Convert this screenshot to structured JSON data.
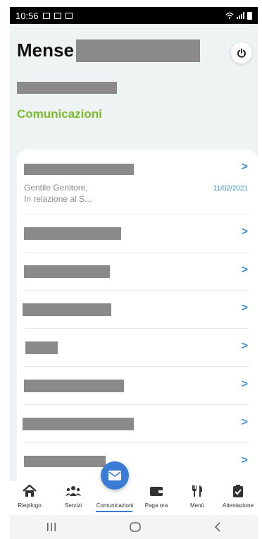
{
  "status_bar": {
    "time": "10:56"
  },
  "header": {
    "title": "Mense"
  },
  "section_title": "Comunicazioni",
  "messages": [
    {
      "preview_line1": "Gentile Genitore,",
      "preview_line2": "In relazione al S...",
      "date": "11/02/2021"
    }
  ],
  "chevron": ">",
  "bottom_nav": {
    "items": [
      {
        "label": "Riepilogo",
        "icon": "home-icon"
      },
      {
        "label": "Servizi",
        "icon": "users-icon"
      },
      {
        "label": "Comunicazioni",
        "icon": "mail-icon"
      },
      {
        "label": "Paga ora",
        "icon": "wallet-icon"
      },
      {
        "label": "Menù",
        "icon": "cutlery-icon"
      },
      {
        "label": "Attestazione",
        "icon": "clipboard-check-icon"
      }
    ],
    "active": "Comunicazioni"
  },
  "colors": {
    "accent": "#3a7bd5",
    "green": "#7cba2f",
    "background": "#eef3f3"
  }
}
